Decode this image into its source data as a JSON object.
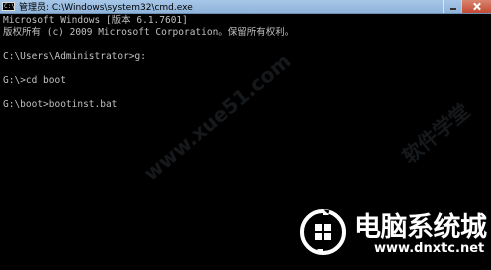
{
  "window": {
    "title": "管理员: C:\\Windows\\system32\\cmd.exe",
    "icon_name": "console-icon",
    "icon_glyph": "C:\\"
  },
  "console": {
    "lines": [
      "Microsoft Windows [版本 6.1.7601]",
      "版权所有 (c) 2009 Microsoft Corporation。保留所有权利。",
      "",
      "C:\\Users\\Administrator>g:",
      "",
      "G:\\>cd boot",
      "",
      "G:\\boot>bootinst.bat"
    ]
  },
  "watermarks": {
    "left": "www.xue51.com",
    "right": "软件学堂"
  },
  "brand": {
    "name": "电脑系统城",
    "url": "www.dnxtc.net"
  }
}
